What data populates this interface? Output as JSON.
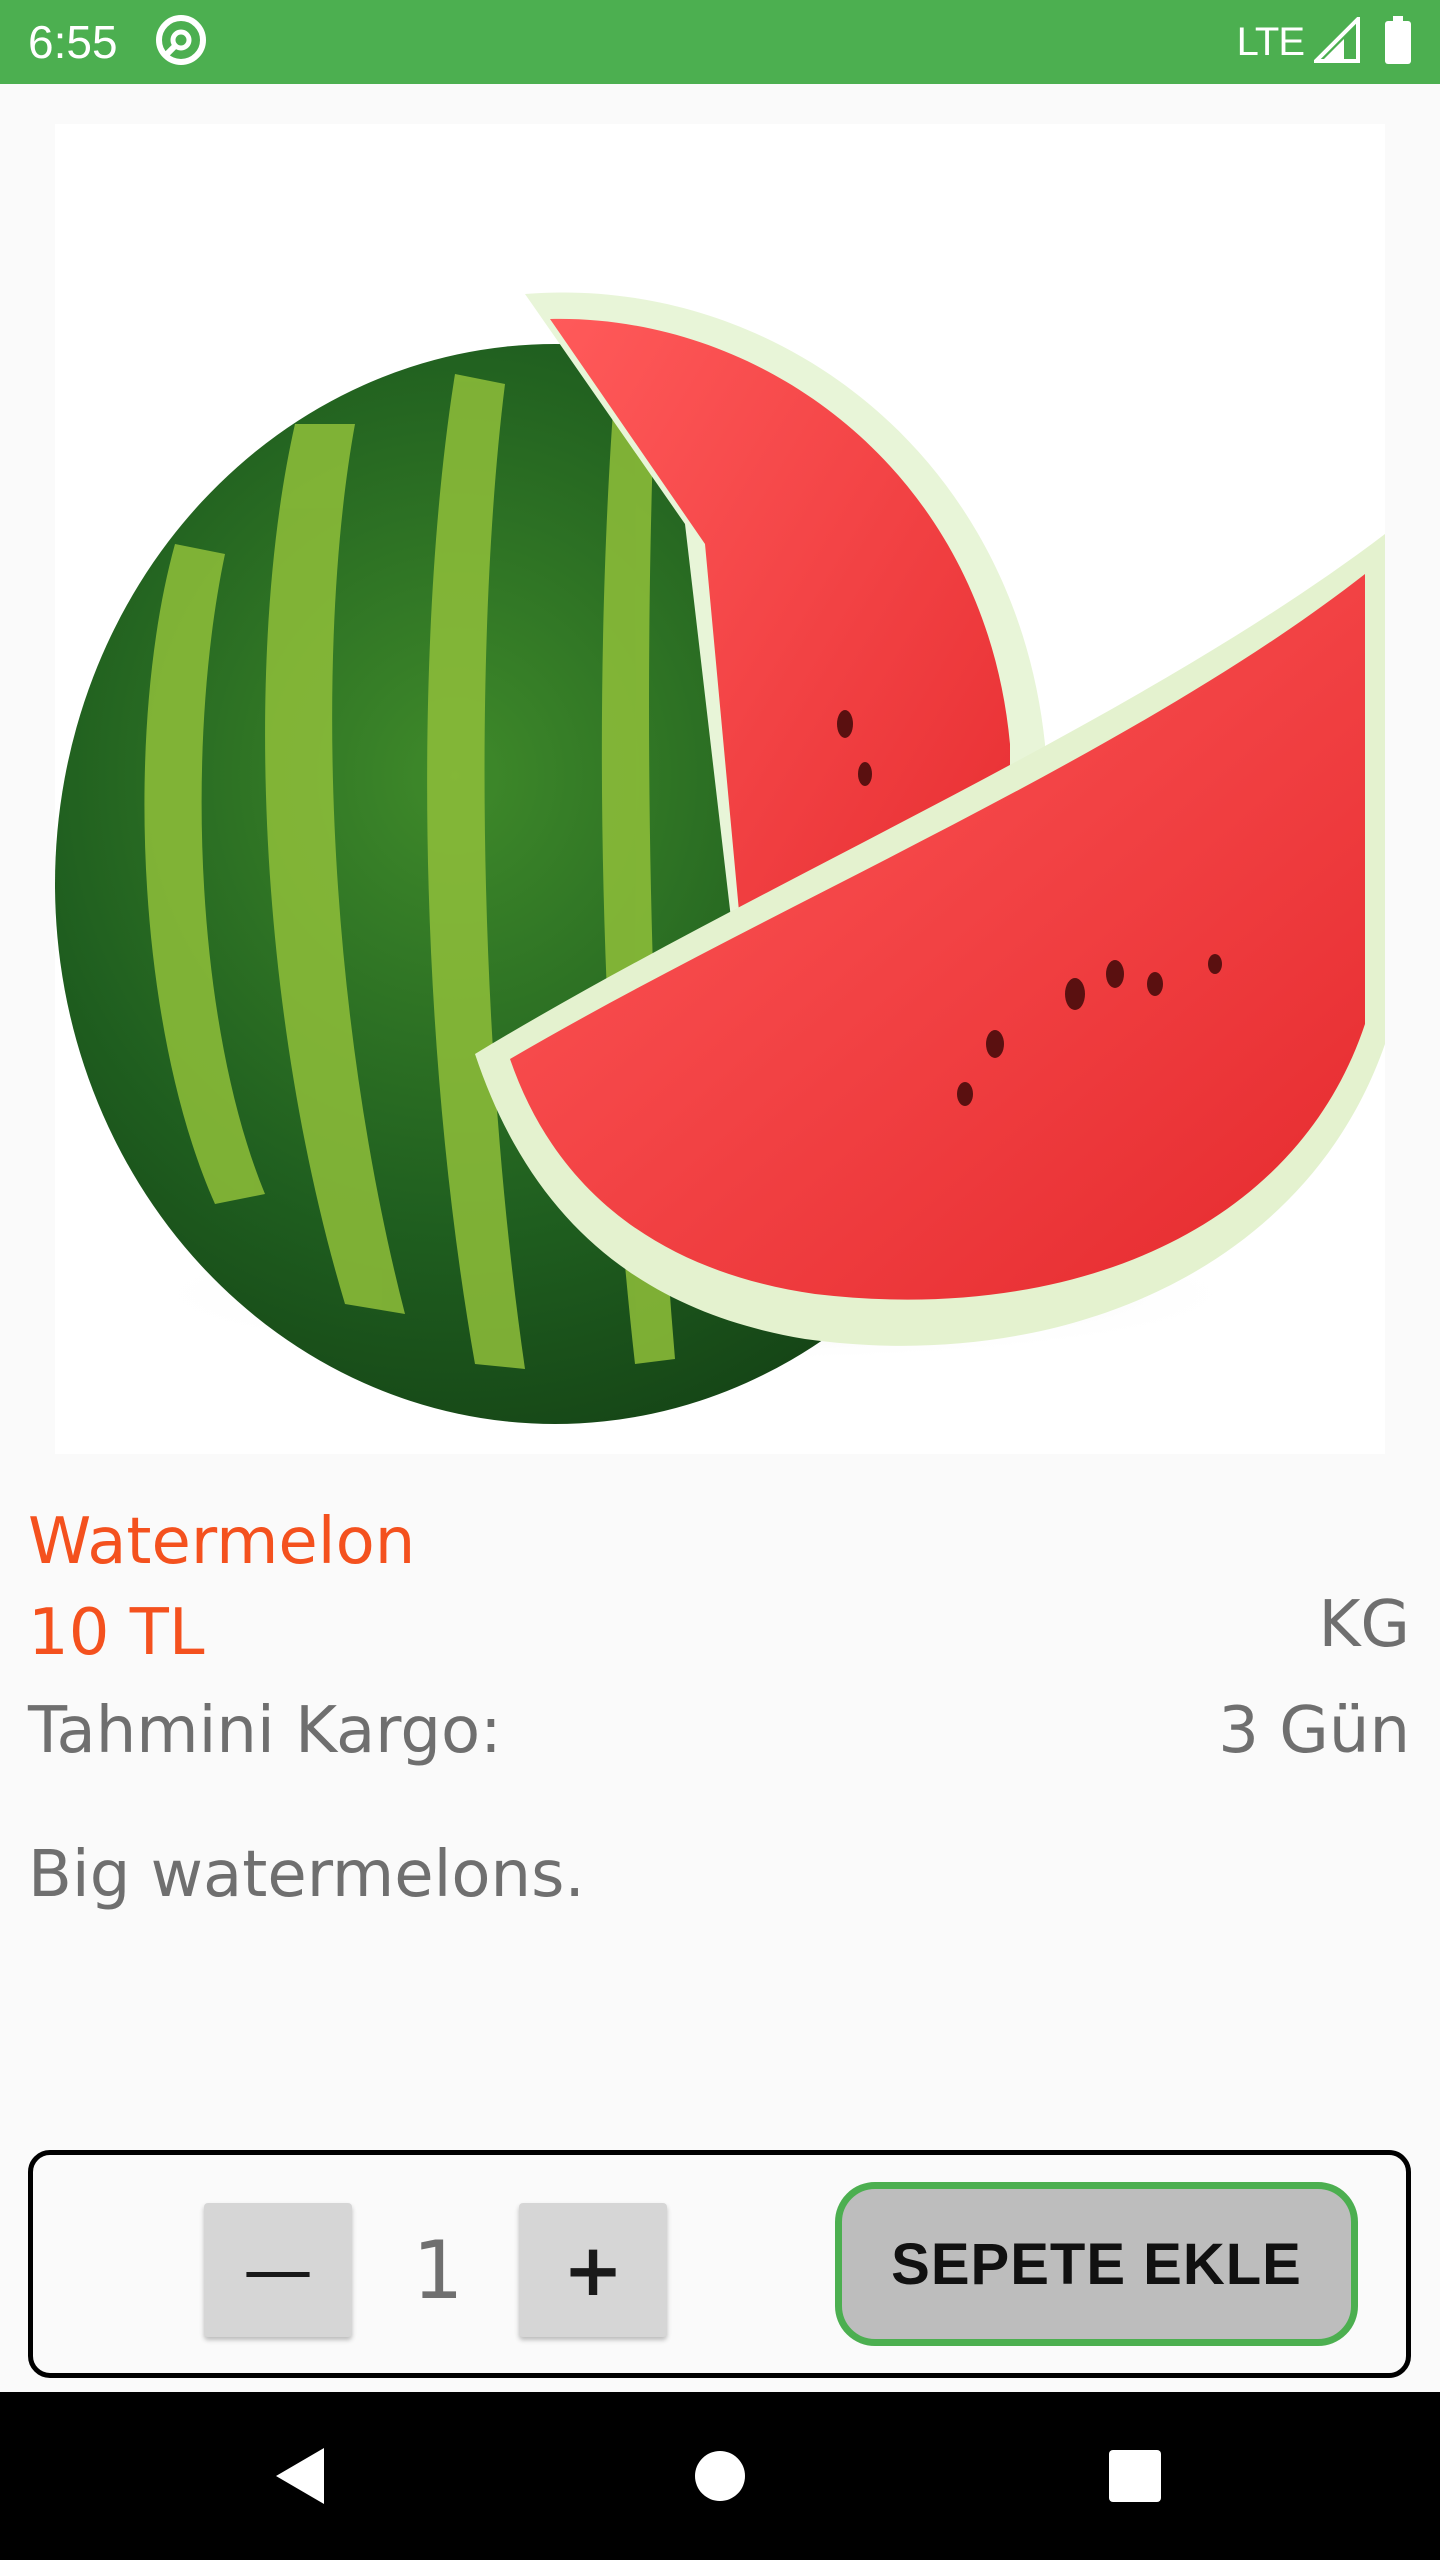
{
  "status_bar": {
    "time": "6:55",
    "network": "LTE",
    "icons": [
      "notification-at-icon",
      "signal-icon",
      "battery-icon"
    ],
    "color": "#4caf50"
  },
  "product": {
    "image_alt": "watermelon-image",
    "name": "Watermelon",
    "price": "10 TL",
    "unit": "KG",
    "cargo_label": "Tahmini Kargo:",
    "cargo_value": "3 Gün",
    "description": "Big watermelons."
  },
  "cart": {
    "minus_label": "—",
    "quantity": "1",
    "plus_label": "+",
    "add_label": "SEPETE EKLE"
  },
  "nav": {
    "icons": [
      "back-icon",
      "home-icon",
      "recents-icon"
    ]
  },
  "colors": {
    "accent": "#f4511e",
    "primary": "#4caf50",
    "text_secondary": "#6f6f6f"
  }
}
